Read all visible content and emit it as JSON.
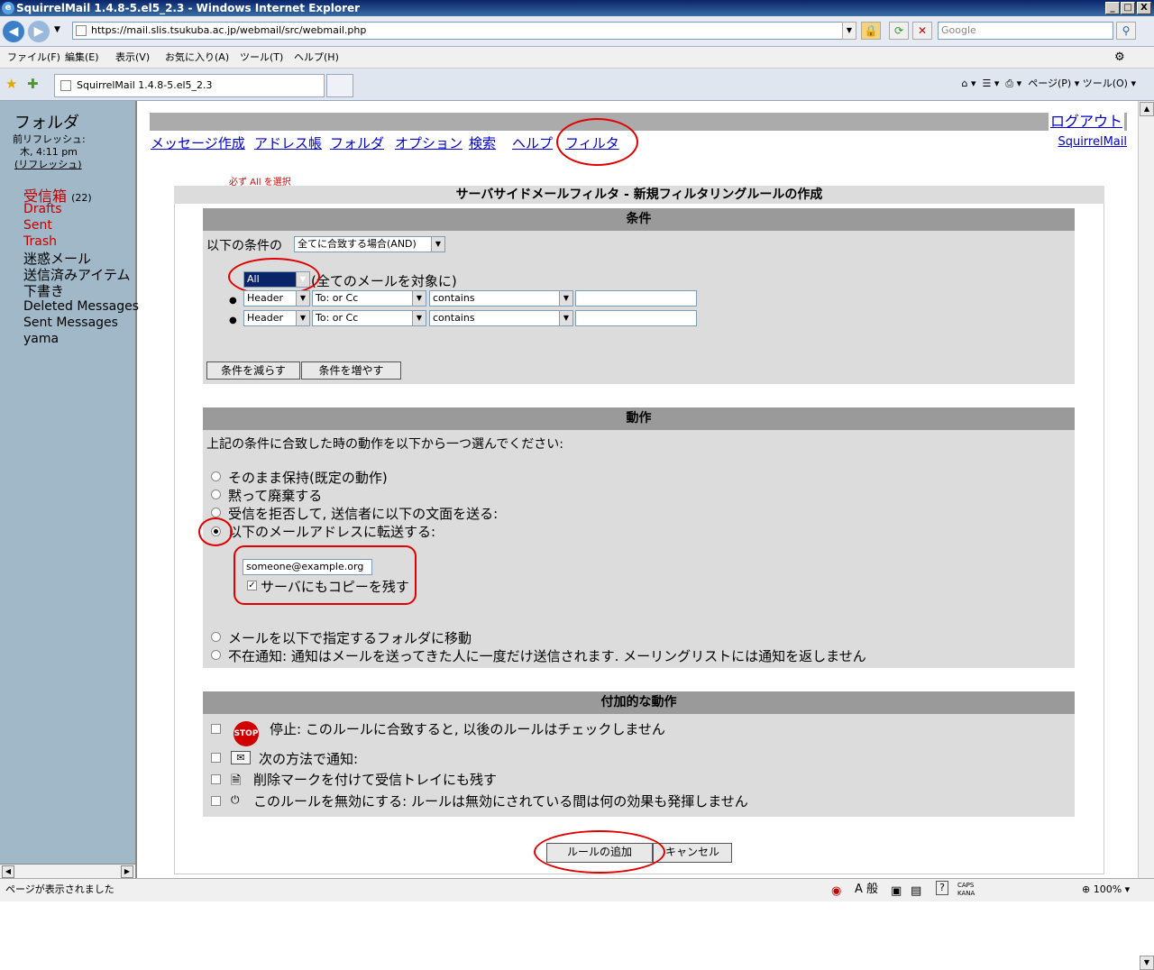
{
  "window": {
    "title": "SquirrelMail 1.4.8-5.el5_2.3 - Windows Internet Explorer",
    "minimize": "_",
    "maximize": "□",
    "close": "X"
  },
  "browser": {
    "address": "https://mail.slis.tsukuba.ac.jp/webmail/src/webmail.php",
    "search_placeholder": "Google",
    "menu": [
      "ファイル(F)",
      "編集(E)",
      "表示(V)",
      "お気に入り(A)",
      "ツール(T)",
      "ヘルプ(H)"
    ],
    "tab_title": "SquirrelMail 1.4.8-5.el5_2.3",
    "tab_tools": "ページ(P) ▾   ツール(O) ▾"
  },
  "sidebar": {
    "heading": "フォルダ",
    "last_refresh_label": "前リフレッシュ:",
    "last_refresh_time": "木, 4:11 pm",
    "refresh_link": "(リフレッシュ)",
    "folders": [
      {
        "label": "受信箱",
        "count": "(22)",
        "color": "#c00000"
      },
      {
        "label": "Drafts",
        "color": "#c00000"
      },
      {
        "label": "Sent",
        "color": "#c00000"
      },
      {
        "label": "Trash",
        "color": "#c00000"
      },
      {
        "label": "迷惑メール",
        "color": "#000000"
      },
      {
        "label": "送信済みアイテム",
        "color": "#000000"
      },
      {
        "label": "下書き",
        "color": "#000000"
      },
      {
        "label": "Deleted Messages",
        "color": "#000000"
      },
      {
        "label": "Sent Messages",
        "color": "#000000"
      },
      {
        "label": "yama",
        "color": "#000000"
      }
    ]
  },
  "topnav": {
    "logout": "ログアウト",
    "links": [
      "メッセージ作成",
      "アドレス帳",
      "フォルダ",
      "オプション",
      "検索",
      "ヘルプ",
      "フィルタ"
    ],
    "brand": "SquirrelMail"
  },
  "annotation": "必ず All を選択",
  "form": {
    "title": "サーバサイドメールフィルタ - 新規フィルタリングルールの作成",
    "conditions": {
      "heading": "条件",
      "match_prefix": "以下の条件の",
      "match_select": "全てに合致する場合(AND)",
      "all_select": "All",
      "all_note": "(全てのメールを対象に)",
      "rows": [
        {
          "type": "Header",
          "field": "To: or Cc",
          "op": "contains",
          "value": ""
        },
        {
          "type": "Header",
          "field": "To: or Cc",
          "op": "contains",
          "value": ""
        }
      ],
      "remove_button": "条件を減らす",
      "add_button": "条件を増やす"
    },
    "actions": {
      "heading": "動作",
      "intro": "上記の条件に合致した時の動作を以下から一つ選んでください:",
      "options": [
        "そのまま保持(既定の動作)",
        "黙って廃棄する",
        "受信を拒否して, 送信者に以下の文面を送る:",
        "以下のメールアドレスに転送する:"
      ],
      "forward_address": "someone@example.org",
      "keep_copy": "サーバにもコピーを残す",
      "move_option": "メールを以下で指定するフォルダに移動",
      "vacation_option": "不在通知: 通知はメールを送ってきた人に一度だけ送信されます. メーリングリストには通知を返しません"
    },
    "additional": {
      "heading": "付加的な動作",
      "stop": "停止: このルールに合致すると, 以後のルールはチェックしません",
      "stop_icon_text": "STOP",
      "notify": "次の方法で通知:",
      "flag_deleted": "削除マークを付けて受信トレイにも残す",
      "disable": "このルールを無効にする: ルールは無効にされている間は何の効果も発揮しません"
    },
    "submit": "ルールの追加",
    "cancel": "キャンセル"
  },
  "status": {
    "text": "ページが表示されました",
    "caps": "CAPS",
    "kana": "KANA",
    "ime": "A 般",
    "zoom": "100%"
  }
}
